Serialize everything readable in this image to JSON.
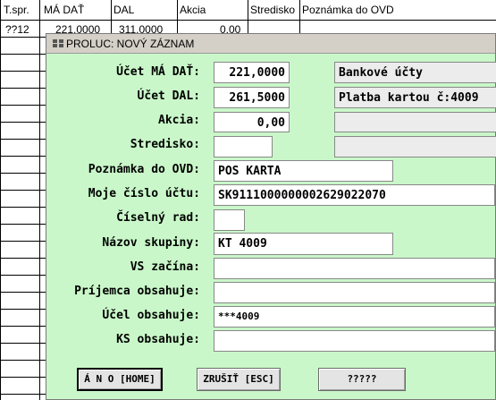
{
  "grid": {
    "columns": [
      "T.spr.",
      "MÁ DAŤ",
      "DAL",
      "Akcia",
      "Stredisko",
      "Poznámka do OVD"
    ],
    "row1": {
      "tspr": "??12",
      "ma_dat": "221,0000",
      "dal": "311,0000",
      "akcia": "0,00"
    }
  },
  "dialog": {
    "title": "PROLUC: NOVÝ ZÁZNAM",
    "fields": {
      "ucet_ma_dat": {
        "label": "Účet MÁ DAŤ:",
        "value": "221,0000",
        "desc": "Bankové účty"
      },
      "ucet_dal": {
        "label": "Účet DAL:",
        "value": "261,5000",
        "desc": "Platba kartou č:4009"
      },
      "akcia": {
        "label": "Akcia:",
        "value": "0,00",
        "desc": ""
      },
      "stredisko": {
        "label": "Stredisko:",
        "value": "",
        "desc": ""
      },
      "poznamka": {
        "label": "Poznámka do OVD:",
        "value": "POS KARTA"
      },
      "cislo_uctu": {
        "label": "Moje číslo účtu:",
        "value": "SK9111000000002629022070"
      },
      "ciselny_rad": {
        "label": "Číselný rad:",
        "value": ""
      },
      "nazov_skupiny": {
        "label": "Názov skupiny:",
        "value": "KT 4009"
      },
      "vs_zacina": {
        "label": "VS začína:",
        "value": ""
      },
      "prijemca": {
        "label": "Príjemca obsahuje:",
        "value": ""
      },
      "ucel": {
        "label": "Účel obsahuje:",
        "value": "***4009"
      },
      "ks": {
        "label": "KS obsahuje:",
        "value": ""
      }
    },
    "buttons": {
      "ano": "Á N O [HOME]",
      "zrusit": "ZRUŠIŤ [ESC]",
      "unknown": "?????"
    }
  },
  "colors": {
    "dialog_bg": "#c9f7c9",
    "titlebar_bg": "#d4d0c8"
  }
}
